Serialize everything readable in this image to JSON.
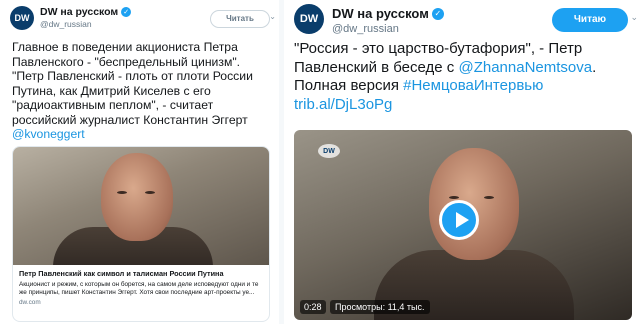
{
  "left_tweet": {
    "avatar_text": "DW",
    "display_name": "DW на русском",
    "handle": "@dw_russian",
    "follow_label": "Читать",
    "lines": [
      "Главное в поведении акциониста Петра",
      "Павленского  - \"беспредельный цинизм\".",
      "\"Петр Павленский - плоть от плоти России",
      "Путина, как Дмитрий Киселев с его",
      "\"радиоактивным пеплом\", - считает",
      "российский журналист Константин Эггерт"
    ],
    "mention": "@kvoneggert",
    "card": {
      "title": "Петр Павленский как символ и талисман России Путина",
      "desc_lines": [
        "Акционист и режим, с которым он борется, на самом деле исповедуют одни и те",
        "же принципы, пишет Константин Эггерт. Хотя свои последние арт-проекты уе..."
      ],
      "domain": "dw.com"
    }
  },
  "right_tweet": {
    "avatar_text": "DW",
    "display_name": "DW на русском",
    "handle": "@dw_russian",
    "follow_label": "Читаю",
    "line1": "\"Россия - это царство-бутафория\", - Петр",
    "line2_text": "Павленский в беседе с ",
    "line2_mention": "@ZhannaNemtsova",
    "line2_end": ".",
    "line3_text": "Полная версия ",
    "line3_hashtag": "#НемцоваИнтервью",
    "line4_link": "trib.al/DjL3oPg",
    "video": {
      "watermark": "DW",
      "duration": "0:28",
      "views": "Просмотры: 11,4 тыс."
    }
  },
  "colors": {
    "link": "#1b95e0",
    "follow_blue": "#1da1f2",
    "dw_blue": "#0a3d6b"
  }
}
